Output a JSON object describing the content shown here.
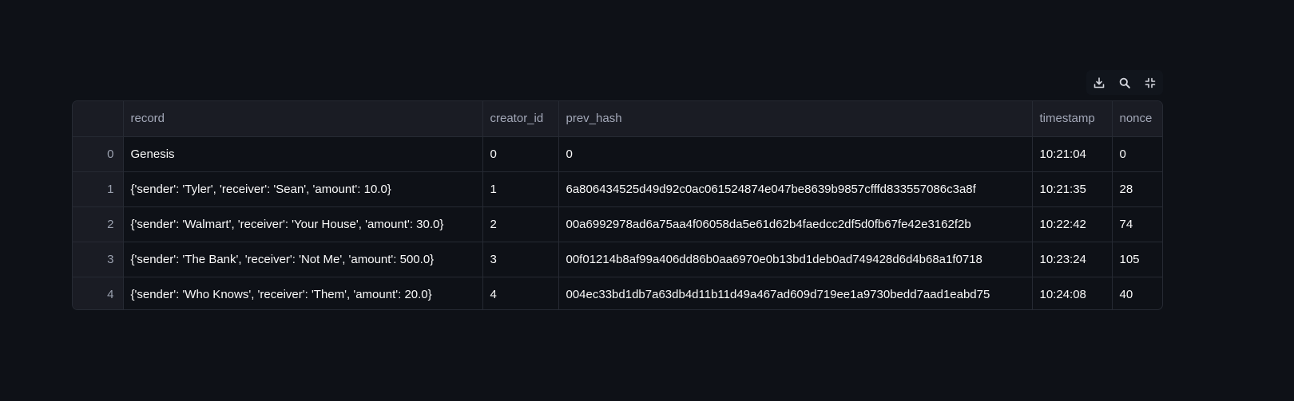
{
  "toolbar": {
    "download_icon": "download-icon",
    "search_icon": "search-icon",
    "collapse_icon": "collapse-icon",
    "icon_color": "#d5d7de"
  },
  "table": {
    "columns": [
      "",
      "record",
      "creator_id",
      "prev_hash",
      "timestamp",
      "nonce"
    ],
    "rows": [
      {
        "index": "0",
        "record": "Genesis",
        "creator_id": "0",
        "prev_hash": "0",
        "timestamp": "10:21:04",
        "nonce": "0"
      },
      {
        "index": "1",
        "record": "{'sender': 'Tyler', 'receiver': 'Sean', 'amount': 10.0}",
        "creator_id": "1",
        "prev_hash": "6a806434525d49d92c0ac061524874e047be8639b9857cfffd833557086c3a8f",
        "timestamp": "10:21:35",
        "nonce": "28"
      },
      {
        "index": "2",
        "record": "{'sender': 'Walmart', 'receiver': 'Your House', 'amount': 30.0}",
        "creator_id": "2",
        "prev_hash": "00a6992978ad6a75aa4f06058da5e61d62b4faedcc2df5d0fb67fe42e3162f2b",
        "timestamp": "10:22:42",
        "nonce": "74"
      },
      {
        "index": "3",
        "record": "{'sender': 'The Bank', 'receiver': 'Not Me', 'amount': 500.0}",
        "creator_id": "3",
        "prev_hash": "00f01214b8af99a406dd86b0aa6970e0b13bd1deb0ad749428d6d4b68a1f0718",
        "timestamp": "10:23:24",
        "nonce": "105"
      },
      {
        "index": "4",
        "record": "{'sender': 'Who Knows', 'receiver': 'Them', 'amount': 20.0}",
        "creator_id": "4",
        "prev_hash": "004ec33bd1db7a63db4d11b11d49a467ad609d719ee1a9730bedd7aad1eabd75",
        "timestamp": "10:24:08",
        "nonce": "40"
      }
    ]
  }
}
